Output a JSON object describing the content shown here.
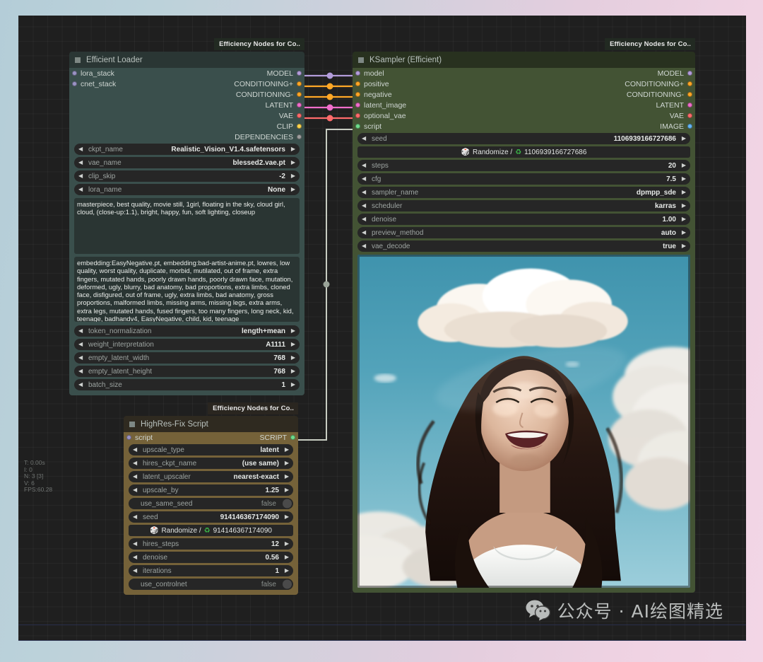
{
  "app": {
    "background_gradient_left": "#b4cdd8",
    "background_gradient_right": "#f3d6e6",
    "canvas_bg": "#1f1f1f"
  },
  "stats": {
    "time": "T: 0.00s",
    "iterations": "I: 0",
    "nodes": "N: 3 [3]",
    "version": "V: 6",
    "fps": "FPS:60.28"
  },
  "watermark": {
    "icon": "wechat-icon",
    "text": "公众号 · AI绘图精选"
  },
  "nodes": {
    "efficient_loader": {
      "badge": "Efficiency Nodes for Co..",
      "title": "Efficient Loader",
      "accent": "#3a4f4c",
      "inputs": [
        {
          "label": "lora_stack",
          "color": "#9a93c4"
        },
        {
          "label": "cnet_stack",
          "color": "#9a93c4"
        }
      ],
      "outputs": [
        {
          "label": "MODEL",
          "color": "#b39ddb"
        },
        {
          "label": "CONDITIONING+",
          "color": "#ffa726"
        },
        {
          "label": "CONDITIONING-",
          "color": "#ffa726"
        },
        {
          "label": "LATENT",
          "color": "#f06ecb"
        },
        {
          "label": "VAE",
          "color": "#ff6b6b"
        },
        {
          "label": "CLIP",
          "color": "#ffd54f"
        },
        {
          "label": "DEPENDENCIES",
          "color": "#9e9e9e"
        }
      ],
      "widgets": [
        {
          "name": "ckpt_name",
          "value": "Realistic_Vision_V1.4.safetensors"
        },
        {
          "name": "vae_name",
          "value": "blessed2.vae.pt"
        },
        {
          "name": "clip_skip",
          "value": "-2"
        },
        {
          "name": "lora_name",
          "value": "None"
        }
      ],
      "positive_prompt": "masterpiece, best quality, movie still, 1girl, floating in the sky, cloud girl, cloud, (close-up:1.1), bright, happy, fun, soft lighting, closeup",
      "negative_prompt": "embedding:EasyNegative.pt, embedding:bad-artist-anime.pt, lowres, low quality, worst quality, duplicate, morbid, mutilated, out of frame, extra fingers, mutated hands, poorly drawn hands, poorly drawn face, mutation, deformed, ugly, blurry, bad anatomy, bad proportions, extra limbs, cloned face, disfigured, out of frame, ugly, extra limbs, bad anatomy, gross proportions, malformed limbs, missing arms, missing legs, extra arms, extra legs, mutated hands, fused fingers, too many fingers, long neck, kid, teenage, badhandv4, EasyNegative, child, kid, teenage",
      "widgets_bottom": [
        {
          "name": "token_normalization",
          "value": "length+mean"
        },
        {
          "name": "weight_interpretation",
          "value": "A1111"
        },
        {
          "name": "empty_latent_width",
          "value": "768"
        },
        {
          "name": "empty_latent_height",
          "value": "768"
        },
        {
          "name": "batch_size",
          "value": "1"
        }
      ]
    },
    "ksampler": {
      "badge": "Efficiency Nodes for Co..",
      "title": "KSampler (Efficient)",
      "accent": "#435334",
      "inputs": [
        {
          "label": "model",
          "color": "#b39ddb"
        },
        {
          "label": "positive",
          "color": "#ffa726"
        },
        {
          "label": "negative",
          "color": "#ffa726"
        },
        {
          "label": "latent_image",
          "color": "#f06ecb"
        },
        {
          "label": "optional_vae",
          "color": "#ff6b6b"
        },
        {
          "label": "script",
          "color": "#6fdc8c"
        }
      ],
      "outputs": [
        {
          "label": "MODEL",
          "color": "#b39ddb"
        },
        {
          "label": "CONDITIONING+",
          "color": "#ffa726"
        },
        {
          "label": "CONDITIONING-",
          "color": "#ffa726"
        },
        {
          "label": "LATENT",
          "color": "#f06ecb"
        },
        {
          "label": "VAE",
          "color": "#ff6b6b"
        },
        {
          "label": "IMAGE",
          "color": "#64b5f6"
        }
      ],
      "widgets": [
        {
          "name": "seed",
          "value": "1106939166727686"
        }
      ],
      "randomize_row": {
        "label": "Randomize /",
        "seed": "1106939166727686"
      },
      "widgets_after": [
        {
          "name": "steps",
          "value": "20"
        },
        {
          "name": "cfg",
          "value": "7.5"
        },
        {
          "name": "sampler_name",
          "value": "dpmpp_sde"
        },
        {
          "name": "scheduler",
          "value": "karras"
        },
        {
          "name": "denoise",
          "value": "1.00"
        },
        {
          "name": "preview_method",
          "value": "auto"
        },
        {
          "name": "vae_decode",
          "value": "true"
        }
      ],
      "preview_alt": "Generated image: smiling woman under a cloud in blue sky"
    },
    "highres_fix": {
      "badge": "Efficiency Nodes for Co..",
      "title": "HighRes-Fix Script",
      "accent": "#756239",
      "inputs": [
        {
          "label": "script",
          "color": "#9a93c4"
        }
      ],
      "outputs": [
        {
          "label": "SCRIPT",
          "color": "#6fdc8c"
        }
      ],
      "widgets": [
        {
          "name": "upscale_type",
          "value": "latent",
          "type": "combo"
        },
        {
          "name": "hires_ckpt_name",
          "value": "(use same)",
          "type": "combo"
        },
        {
          "name": "latent_upscaler",
          "value": "nearest-exact",
          "type": "combo"
        },
        {
          "name": "upscale_by",
          "value": "1.25",
          "type": "number"
        },
        {
          "name": "use_same_seed",
          "value": "false",
          "type": "toggle"
        },
        {
          "name": "seed",
          "value": "914146367174090",
          "type": "number"
        }
      ],
      "randomize_row": {
        "label": "Randomize /",
        "seed": "914146367174090"
      },
      "widgets_after": [
        {
          "name": "hires_steps",
          "value": "12",
          "type": "number"
        },
        {
          "name": "denoise",
          "value": "0.56",
          "type": "number"
        },
        {
          "name": "iterations",
          "value": "1",
          "type": "number"
        },
        {
          "name": "use_controlnet",
          "value": "false",
          "type": "toggle"
        }
      ]
    }
  },
  "links": [
    {
      "from": "efficient_loader.MODEL",
      "to": "ksampler.model",
      "color": "#b39ddb"
    },
    {
      "from": "efficient_loader.CONDITIONING+",
      "to": "ksampler.positive",
      "color": "#ffa726"
    },
    {
      "from": "efficient_loader.CONDITIONING-",
      "to": "ksampler.negative",
      "color": "#ffa726"
    },
    {
      "from": "efficient_loader.LATENT",
      "to": "ksampler.latent_image",
      "color": "#f06ecb"
    },
    {
      "from": "efficient_loader.VAE",
      "to": "ksampler.optional_vae",
      "color": "#ff6b6b"
    },
    {
      "from": "highres_fix.SCRIPT",
      "to": "ksampler.script",
      "color": "#c8cdc2"
    }
  ]
}
